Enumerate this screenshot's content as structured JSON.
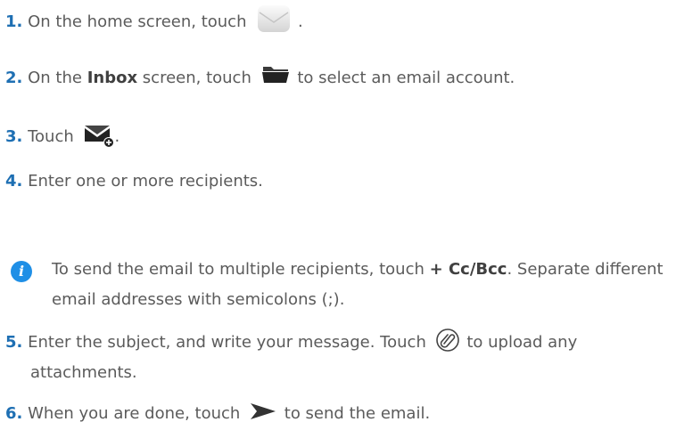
{
  "steps": [
    {
      "num": "1.",
      "before": "On the home screen, touch",
      "after": "."
    },
    {
      "num": "2.",
      "before": "On the",
      "bold": "Inbox",
      "middle": "screen, touch",
      "after": "to select an email account."
    },
    {
      "num": "3.",
      "before": "Touch",
      "after": "."
    },
    {
      "num": "4.",
      "before": "Enter one or more recipients."
    },
    {
      "num": "5.",
      "before": "Enter the subject, and write your message. Touch",
      "after": "to upload any",
      "cont": "attachments."
    },
    {
      "num": "6.",
      "before": "When you are done, touch",
      "after": "to send the email."
    }
  ],
  "note": {
    "before": "To send the email to multiple recipients, touch",
    "bold": "+ Cc/Bcc",
    "after": ". Separate different email addresses with semicolons (;)."
  },
  "icons": {
    "email_app": "email-app-icon",
    "folder": "folder-icon",
    "compose": "compose-icon",
    "attach": "paperclip-icon",
    "send": "send-icon",
    "note": "info-icon"
  }
}
